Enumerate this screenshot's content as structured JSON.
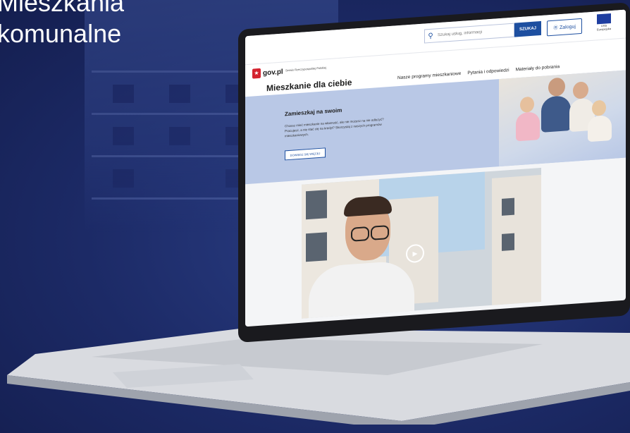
{
  "headline": {
    "line1": "Mieszkania",
    "line2": "komunalne"
  },
  "topbar": {
    "search_placeholder": "Szukaj usług, informacji",
    "search_button": "SZUKAJ",
    "login_button": "Zaloguj",
    "eu_label": "Unia Europejska"
  },
  "site": {
    "logo_text": "gov.pl",
    "tagline": "Serwis Rzeczypospolitej Polskiej",
    "title": "Mieszkanie dla ciebie",
    "nav": [
      "Nasze programy mieszkaniowe",
      "Pytania i odpowiedzi",
      "Materiały do pobrania"
    ]
  },
  "hero": {
    "title": "Zamieszkaj na swoim",
    "text": "Chcesz mieć mieszkanie na własność, ale nie możesz na nie odłożyć? Pracujesz, a nie stać cię na kredyt? Skorzystaj z naszych programów mieszkaniowych.",
    "button": "DOWIEDZ SIĘ WIĘCEJ"
  },
  "colors": {
    "accent": "#1d4fa0",
    "background": "#1c2a66",
    "hero": "#b9c8e6"
  }
}
